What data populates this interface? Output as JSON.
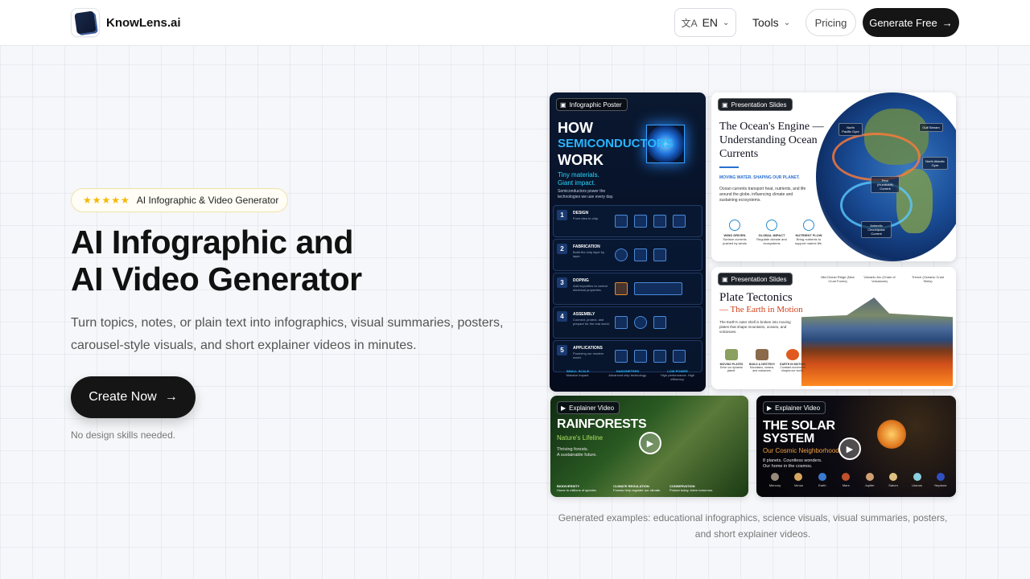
{
  "header": {
    "brand": "KnowLens.ai",
    "language": "EN",
    "tools_label": "Tools",
    "pricing_label": "Pricing",
    "generate_label": "Generate Free"
  },
  "hero": {
    "badge_stars": "★★★★★",
    "badge_text": "AI Infographic & Video Generator",
    "title_line1": "AI Infographic and",
    "title_line2": "AI Video Generator",
    "subtitle": "Turn topics, notes, or plain text into infographics, visual summaries, posters, carousel-style visuals, and short explainer videos in minutes.",
    "cta_label": "Create Now",
    "note": "No design skills needed."
  },
  "gallery": {
    "poster": {
      "tag": "Infographic Poster",
      "title_how": "HOW",
      "title_semi": "SEMICONDUCTORS",
      "title_work": "WORK",
      "sub1": "Tiny materials.",
      "sub2": "Giant impact.",
      "sub3": "Semiconductors power the technologies we use every day.",
      "steps": [
        {
          "num": "1",
          "label": "DESIGN",
          "desc": "From idea to chip."
        },
        {
          "num": "2",
          "label": "FABRICATION",
          "desc": "Build the chip layer by layer."
        },
        {
          "num": "3",
          "label": "DOPING",
          "desc": "Add impurities to control electrical properties."
        },
        {
          "num": "4",
          "label": "ASSEMBLY",
          "desc": "Connect, protect, and prepare for the real world."
        },
        {
          "num": "5",
          "label": "APPLICATIONS",
          "desc": "Powering our modern world."
        }
      ],
      "footer": [
        {
          "label": "SMALL SCALE",
          "desc": "Massive impact."
        },
        {
          "label": "NANOMETERS",
          "desc": "Advanced chip technology."
        },
        {
          "label": "LOW POWER",
          "desc": "High performance. High efficiency."
        }
      ]
    },
    "ocean": {
      "tag": "Presentation Slides",
      "title": "The Ocean's Engine — Understanding Ocean Currents",
      "sub": "MOVING WATER. SHAPING OUR PLANET.",
      "body": "Ocean currents transport heat, nutrients, and life around the globe, influencing climate and sustaining ecosystems.",
      "icons": [
        {
          "label": "WIND DRIVEN",
          "desc": "Surface currents pushed by winds"
        },
        {
          "label": "GLOBAL IMPACT",
          "desc": "Regulate climate and ecosystems"
        },
        {
          "label": "NUTRIENT FLOW",
          "desc": "Bring nutrients to support marine life."
        }
      ],
      "labels": {
        "north_pacific": "North Pacific Gyre",
        "gulf_stream": "Gulf Stream",
        "north_atlantic": "North Atlantic Gyre",
        "peru": "Peru (Humboldt) Current",
        "antarctic": "Antarctic Circumpolar Current"
      }
    },
    "plate": {
      "tag": "Presentation Slides",
      "title": "Plate Tectonics",
      "title2": "— The Earth in Motion",
      "body": "The Earth's outer shell is broken into moving plates that shape mountains, oceans, and volcanoes.",
      "icons": [
        {
          "label": "MOVING PLATES",
          "desc": "Drive our dynamic planet."
        },
        {
          "label": "BUILD & DESTROY",
          "desc": "Mountains, oceans, and volcanoes."
        },
        {
          "label": "EARTH IN MOTION",
          "desc": "Constant movement shapes our world."
        }
      ],
      "labels": {
        "ridge": "Mid-Ocean Ridge (New Crust Forms)",
        "arc": "Volcanic Arc (Chain of Volcanoes)",
        "trench": "Trench (Oceanic Crust Sinks)"
      }
    },
    "rainforest": {
      "tag": "Explainer Video",
      "title": "RAINFORESTS",
      "sub": "Nature's Lifeline",
      "body1": "Thriving forests.",
      "body2": "A sustainable future.",
      "footer": [
        {
          "label": "BIODIVERSITY",
          "desc": "Home to millions of species."
        },
        {
          "label": "CLIMATE REGULATION",
          "desc": "Forests help regulate our climate."
        },
        {
          "label": "CONSERVATION",
          "desc": "Protect today, thrive tomorrow."
        }
      ]
    },
    "solar": {
      "tag": "Explainer Video",
      "title_line1": "THE SOLAR",
      "title_line2": "SYSTEM",
      "sub": "Our Cosmic Neighborhood",
      "body1": "8 planets. Countless wonders.",
      "body2": "Our home in the cosmos.",
      "planets": [
        {
          "name": "Mercury",
          "color": "#9a8a7a"
        },
        {
          "name": "Venus",
          "color": "#d8a860"
        },
        {
          "name": "Earth",
          "color": "#3a7ad0"
        },
        {
          "name": "Mars",
          "color": "#c0502a"
        },
        {
          "name": "Jupiter",
          "color": "#d0a070"
        },
        {
          "name": "Saturn",
          "color": "#e0c080"
        },
        {
          "name": "Uranus",
          "color": "#8ad0e0"
        },
        {
          "name": "Neptune",
          "color": "#3050c0"
        }
      ]
    },
    "caption": "Generated examples: educational infographics, science visuals, visual summaries, posters, and short explainer videos."
  }
}
